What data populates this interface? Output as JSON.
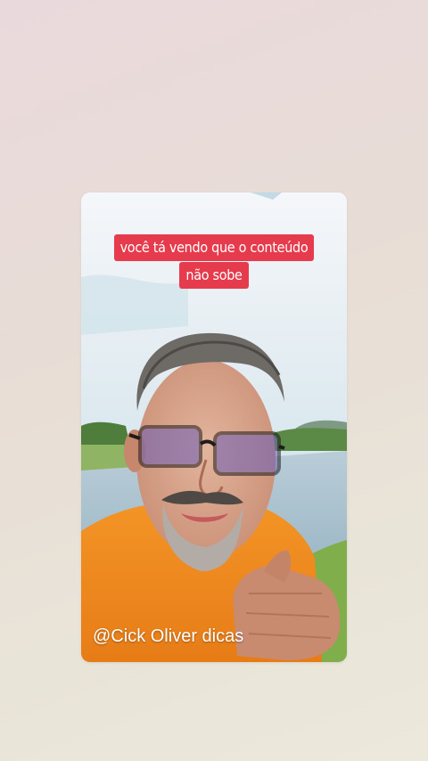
{
  "story": {
    "caption_lines": [
      "você tá vendo que o conteúdo",
      "não sobe"
    ],
    "watermark": "@Cick Oliver dicas"
  },
  "colors": {
    "caption_background": "#e63b4c",
    "caption_text": "#ffffff",
    "shirt": "#f08a1f"
  }
}
